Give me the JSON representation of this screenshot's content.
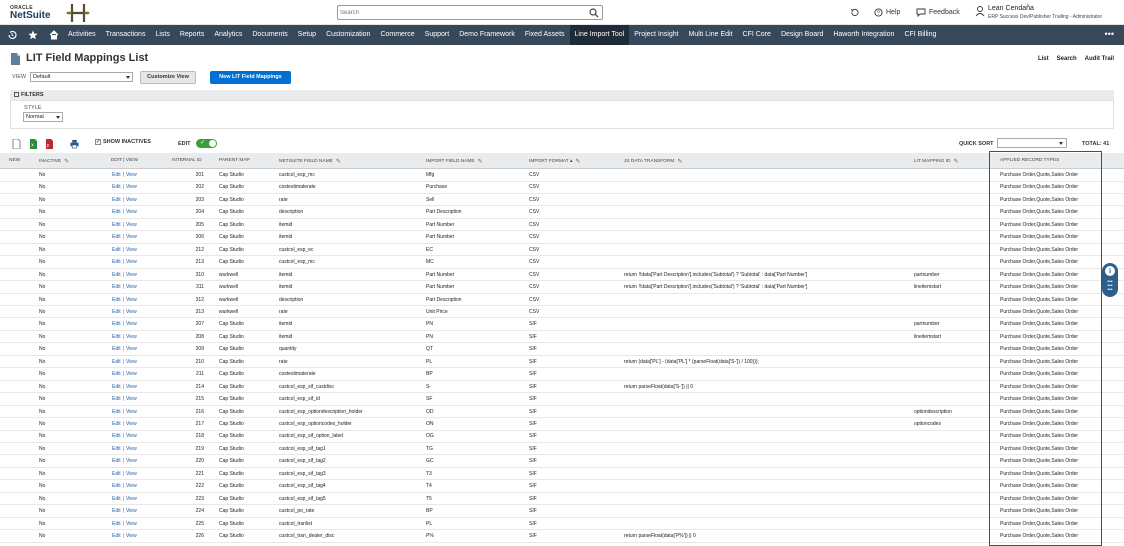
{
  "header": {
    "oracle": "ORACLE",
    "netsuite": "NetSuite",
    "search_placeholder": "Search",
    "help": "Help",
    "feedback": "Feedback",
    "user_name": "Lean Cendaña",
    "user_role": "ERP Success Dev/Publisher Trailing - Administrator"
  },
  "nav": {
    "items": [
      "Activities",
      "Transactions",
      "Lists",
      "Reports",
      "Analytics",
      "Documents",
      "Setup",
      "Customization",
      "Commerce",
      "Support",
      "Demo Framework",
      "Fixed Assets",
      "Line Import Tool",
      "Project Insight",
      "Multi Line Edit",
      "CFI Core",
      "Design Board",
      "Haworth Integration",
      "CFI Billing"
    ],
    "active": "Line Import Tool",
    "more": "•••"
  },
  "page": {
    "title": "LIT Field Mappings List",
    "links": [
      "List",
      "Search",
      "Audit Trail"
    ],
    "view_label": "VIEW",
    "view_value": "Default",
    "customize_view": "Customize View",
    "new_button": "New LIT Field Mappings",
    "filters_label": "FILTERS",
    "style_label": "STYLE",
    "style_value": "Normal",
    "show_inactives": "SHOW INACTIVES",
    "edit_label": "EDIT",
    "quick_sort_label": "QUICK SORT",
    "total": "TOTAL: 41"
  },
  "columns": [
    "NEW",
    "INACTIVE",
    "EDIT | VIEW",
    "INTERNAL ID",
    "PARENT MAP",
    "NETSUITE FIELD NAME",
    "IMPORT FIELD NAME",
    "IMPORT FORMAT ▴",
    "JS DATA TRANSFORM",
    "LIT MAPPING ID",
    "APPLIED RECORD TYPES"
  ],
  "rows": [
    {
      "inactive": "No",
      "id": "201",
      "parent": "Cap Studio",
      "ns": "custcol_esp_mc",
      "imp": "Mfg",
      "fmt": "CSV",
      "js": "",
      "lit": "",
      "art": "Purchase Order,Quote,Sales Order"
    },
    {
      "inactive": "No",
      "id": "202",
      "parent": "Cap Studio",
      "ns": "costestimaterate",
      "imp": "Purchase",
      "fmt": "CSV",
      "js": "",
      "lit": "",
      "art": "Purchase Order,Quote,Sales Order"
    },
    {
      "inactive": "No",
      "id": "203",
      "parent": "Cap Studio",
      "ns": "rate",
      "imp": "Sell",
      "fmt": "CSV",
      "js": "",
      "lit": "",
      "art": "Purchase Order,Quote,Sales Order"
    },
    {
      "inactive": "No",
      "id": "204",
      "parent": "Cap Studio",
      "ns": "description",
      "imp": "Part Description",
      "fmt": "CSV",
      "js": "",
      "lit": "",
      "art": "Purchase Order,Quote,Sales Order"
    },
    {
      "inactive": "No",
      "id": "205",
      "parent": "Cap Studio",
      "ns": "itemid",
      "imp": "Part Number",
      "fmt": "CSV",
      "js": "",
      "lit": "",
      "art": "Purchase Order,Quote,Sales Order"
    },
    {
      "inactive": "No",
      "id": "206",
      "parent": "Cap Studio",
      "ns": "itemid",
      "imp": "Part Number",
      "fmt": "CSV",
      "js": "",
      "lit": "",
      "art": "Purchase Order,Quote,Sales Order"
    },
    {
      "inactive": "No",
      "id": "212",
      "parent": "Cap Studio",
      "ns": "custcol_esp_ec",
      "imp": "EC",
      "fmt": "CSV",
      "js": "",
      "lit": "",
      "art": "Purchase Order,Quote,Sales Order"
    },
    {
      "inactive": "No",
      "id": "213",
      "parent": "Cap Studio",
      "ns": "custcol_esp_mc",
      "imp": "MC",
      "fmt": "CSV",
      "js": "",
      "lit": "",
      "art": "Purchase Order,Quote,Sales Order"
    },
    {
      "inactive": "No",
      "id": "310",
      "parent": "wurkwell",
      "ns": "itemid",
      "imp": "Part Number",
      "fmt": "CSV",
      "js": "return !!data['Part Description'].includes('Subtotal') ? 'Subtotal' : data['Part Number']",
      "lit": "partnumber",
      "art": "Purchase Order,Quote,Sales Order"
    },
    {
      "inactive": "No",
      "id": "311",
      "parent": "wurkwell",
      "ns": "itemid",
      "imp": "Part Number",
      "fmt": "CSV",
      "js": "return !!data['Part Description'].includes('Subtotal') ? 'Subtotal' : data['Part Number']",
      "lit": "lineitemstart",
      "art": "Purchase Order,Quote,Sales Order"
    },
    {
      "inactive": "No",
      "id": "312",
      "parent": "wurkwell",
      "ns": "description",
      "imp": "Part Description",
      "fmt": "CSV",
      "js": "",
      "lit": "",
      "art": "Purchase Order,Quote,Sales Order"
    },
    {
      "inactive": "No",
      "id": "313",
      "parent": "wurkwell",
      "ns": "rate",
      "imp": "Unit Price",
      "fmt": "CSV",
      "js": "",
      "lit": "",
      "art": "Purchase Order,Quote,Sales Order"
    },
    {
      "inactive": "No",
      "id": "207",
      "parent": "Cap Studio",
      "ns": "itemid",
      "imp": "PN",
      "fmt": "SIF",
      "js": "",
      "lit": "partnumber",
      "art": "Purchase Order,Quote,Sales Order"
    },
    {
      "inactive": "No",
      "id": "208",
      "parent": "Cap Studio",
      "ns": "itemid",
      "imp": "PN",
      "fmt": "SIF",
      "js": "",
      "lit": "lineitemstart",
      "art": "Purchase Order,Quote,Sales Order"
    },
    {
      "inactive": "No",
      "id": "209",
      "parent": "Cap Studio",
      "ns": "quantity",
      "imp": "QT",
      "fmt": "SIF",
      "js": "",
      "lit": "",
      "art": "Purchase Order,Quote,Sales Order"
    },
    {
      "inactive": "No",
      "id": "210",
      "parent": "Cap Studio",
      "ns": "rate",
      "imp": "PL",
      "fmt": "SIF",
      "js": "return (data['PL'] - (data['PL'] * (parseFloat(data['S-']) / 100)));",
      "lit": "",
      "art": "Purchase Order,Quote,Sales Order"
    },
    {
      "inactive": "No",
      "id": "211",
      "parent": "Cap Studio",
      "ns": "costestimaterate",
      "imp": "BP",
      "fmt": "SIF",
      "js": "",
      "lit": "",
      "art": "Purchase Order,Quote,Sales Order"
    },
    {
      "inactive": "No",
      "id": "214",
      "parent": "Cap Studio",
      "ns": "custcol_esp_sif_custdisc",
      "imp": "S-",
      "fmt": "SIF",
      "js": "return parseFloat(data['S-']) || 0",
      "lit": "",
      "art": "Purchase Order,Quote,Sales Order"
    },
    {
      "inactive": "No",
      "id": "215",
      "parent": "Cap Studio",
      "ns": "custcol_esp_sif_id",
      "imp": "SF",
      "fmt": "SIF",
      "js": "",
      "lit": "",
      "art": "Purchase Order,Quote,Sales Order"
    },
    {
      "inactive": "No",
      "id": "216",
      "parent": "Cap Studio",
      "ns": "custcol_esp_optiondescription_holder",
      "imp": "OD",
      "fmt": "SIF",
      "js": "",
      "lit": "optiondescription",
      "art": "Purchase Order,Quote,Sales Order"
    },
    {
      "inactive": "No",
      "id": "217",
      "parent": "Cap Studio",
      "ns": "custcol_esp_optioncodes_holder",
      "imp": "ON",
      "fmt": "SIF",
      "js": "",
      "lit": "optioncodes",
      "art": "Purchase Order,Quote,Sales Order"
    },
    {
      "inactive": "No",
      "id": "218",
      "parent": "Cap Studio",
      "ns": "custcol_esp_sif_option_label",
      "imp": "OG",
      "fmt": "SIF",
      "js": "",
      "lit": "",
      "art": "Purchase Order,Quote,Sales Order"
    },
    {
      "inactive": "No",
      "id": "219",
      "parent": "Cap Studio",
      "ns": "custcol_esp_sif_tag1",
      "imp": "TG",
      "fmt": "SIF",
      "js": "",
      "lit": "",
      "art": "Purchase Order,Quote,Sales Order"
    },
    {
      "inactive": "No",
      "id": "220",
      "parent": "Cap Studio",
      "ns": "custcol_esp_sif_tag2",
      "imp": "GC",
      "fmt": "SIF",
      "js": "",
      "lit": "",
      "art": "Purchase Order,Quote,Sales Order"
    },
    {
      "inactive": "No",
      "id": "221",
      "parent": "Cap Studio",
      "ns": "custcol_esp_sif_tag3",
      "imp": "T3",
      "fmt": "SIF",
      "js": "",
      "lit": "",
      "art": "Purchase Order,Quote,Sales Order"
    },
    {
      "inactive": "No",
      "id": "222",
      "parent": "Cap Studio",
      "ns": "custcol_esp_sif_tag4",
      "imp": "T4",
      "fmt": "SIF",
      "js": "",
      "lit": "",
      "art": "Purchase Order,Quote,Sales Order"
    },
    {
      "inactive": "No",
      "id": "223",
      "parent": "Cap Studio",
      "ns": "custcol_esp_sif_tag5",
      "imp": "T5",
      "fmt": "SIF",
      "js": "",
      "lit": "",
      "art": "Purchase Order,Quote,Sales Order"
    },
    {
      "inactive": "No",
      "id": "224",
      "parent": "Cap Studio",
      "ns": "custcol_po_rate",
      "imp": "BP",
      "fmt": "SIF",
      "js": "",
      "lit": "",
      "art": "Purchase Order,Quote,Sales Order"
    },
    {
      "inactive": "No",
      "id": "225",
      "parent": "Cap Studio",
      "ns": "custcol_tranlist",
      "imp": "PL",
      "fmt": "SIF",
      "js": "",
      "lit": "",
      "art": "Purchase Order,Quote,Sales Order"
    },
    {
      "inactive": "No",
      "id": "226",
      "parent": "Cap Studio",
      "ns": "custcol_tran_dealer_disc",
      "imp": "P%",
      "fmt": "SIF",
      "js": "return parseFloat(data['P%']) || 0",
      "lit": "",
      "art": "Purchase Order,Quote,Sales Order"
    }
  ],
  "row_links": {
    "edit": "Edit",
    "sep": "|",
    "view": "View"
  },
  "colors": {
    "nav_bg": "#37485a",
    "link": "#1f5ea8",
    "primary_button": "#0070d2",
    "highlight": "#dd1111",
    "toggle_on": "#3a9f3a"
  }
}
